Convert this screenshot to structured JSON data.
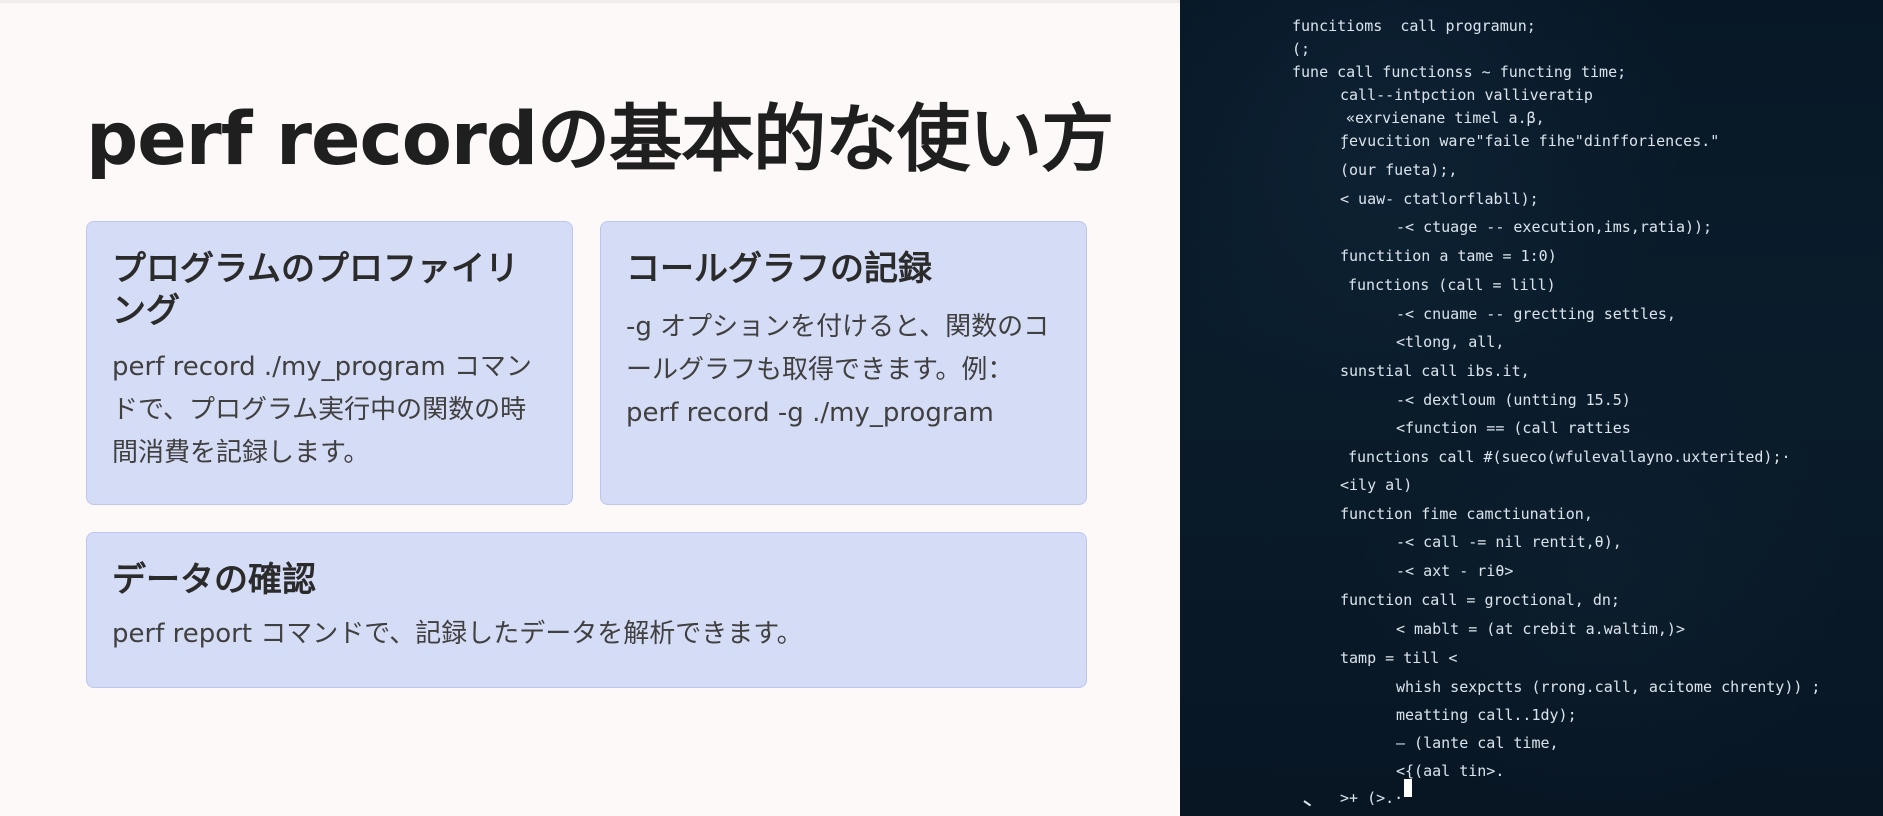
{
  "slide": {
    "title": "perf recordの基本的な使い方"
  },
  "cards": [
    {
      "title": "プログラムのプロファイリング",
      "body": "perf record ./my_program コマンドで、プログラム実行中の関数の時間消費を記録します。"
    },
    {
      "title": "コールグラフの記録",
      "body": "-g オプションを付けると、関数のコールグラフも取得できます。例：perf record -g ./my_program"
    },
    {
      "title": "データの確認",
      "body": "perf report コマンドで、記録したデータを解析できます。"
    }
  ],
  "code_panel": {
    "lines": [
      "funcitioms  call programun;",
      "(;",
      "fune call functionss ~ functing time;",
      "call--intpction valliveratip",
      "«exrvienane timel a.β,",
      "ƒevucition ware\"faile fihe\"dinfforiences.\"",
      "(our fueta);,",
      "< uaw- ctatlorflabll);",
      "-< ctuage -- execution,ims,ratia));",
      "functition a tame = 1:0)",
      "functions (call = lill)",
      "-< cnuame -- grectting settles,",
      "<tlong, all,",
      "sunstial call ibs.it,",
      "-< dextloum (untting 15.5)",
      "<function == (call ratties",
      "functions call #(sueco(wfulevallayno.uxterited);·",
      "<ily al)",
      "function fime camctiunation,",
      "-< call -= nil rentit,θ),",
      "-< axt - riθ>",
      "function call = groctional, dn;",
      "< mablt = (at crebit a.waltim,)>",
      "tamp = till <",
      "whish sexpctts (rrong.call, acitome chrenty)) ;",
      "meatting call..1dy);",
      "— (lante cal time,",
      "<{(aal tin>.",
      ">+ (>.·"
    ],
    "accent": "#0a1c2b"
  }
}
